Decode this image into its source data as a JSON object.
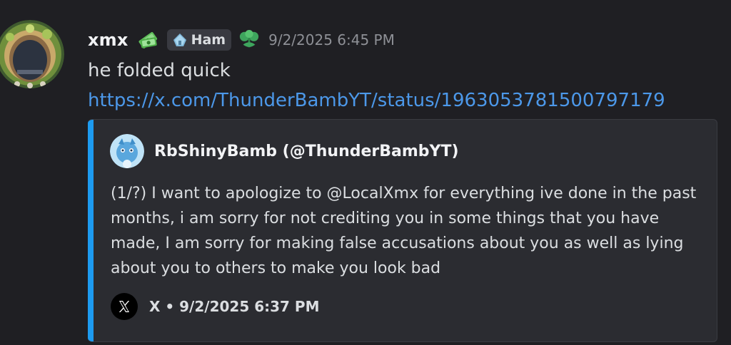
{
  "message": {
    "username": "xmx",
    "role_tag": "Ham",
    "timestamp": "9/2/2025 6:45 PM",
    "text": "he folded quick",
    "link": "https://x.com/ThunderBambYT/status/1963053781500797179"
  },
  "embed": {
    "author": "RbShinyBamb (@ThunderBambYT)",
    "description": "(1/?) I want to apologize to @LocalXmx for everything ive done in the past months, i am sorry for not crediting you in some things that you have made, I am sorry for making false accusations about you as well as lying about you to others to make you look bad",
    "footer": "X • 9/2/2025 6:37 PM",
    "accent_color": "#1d9bf0"
  },
  "icons": {
    "badge_1": "money-icon",
    "tag_icon": "house-icon",
    "badge_2": "plant-icon",
    "footer_icon": "x-logo-icon"
  },
  "colors": {
    "background": "#1f1f23",
    "link": "#4c98e9",
    "timestamp": "#8e9096"
  }
}
